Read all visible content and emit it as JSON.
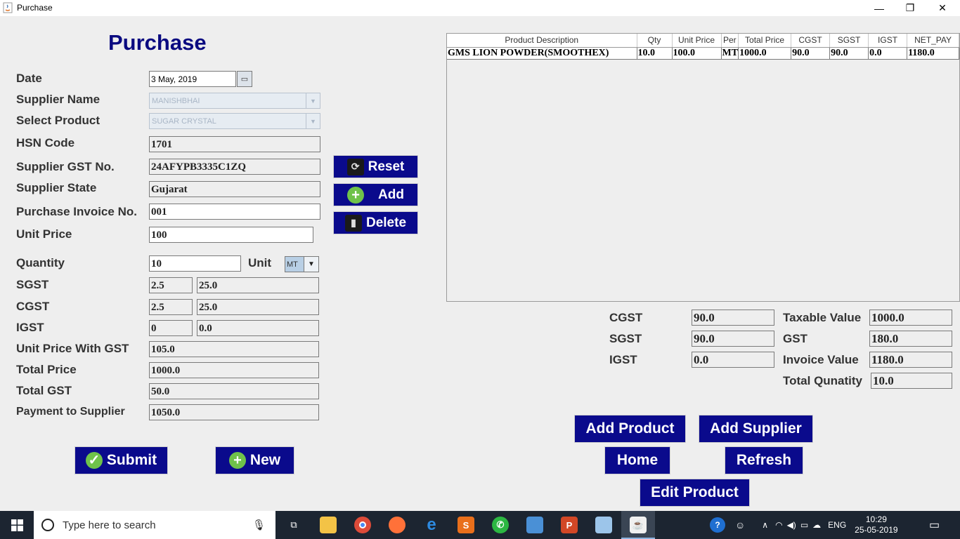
{
  "window": {
    "title": "Purchase",
    "minimize": "—",
    "restore": "❐",
    "close": "✕"
  },
  "form": {
    "heading": "Purchase",
    "date": {
      "label": "Date",
      "value": "3 May, 2019"
    },
    "supplier_name": {
      "label": "Supplier Name",
      "value": "MANISHBHAI"
    },
    "select_product": {
      "label": "Select Product",
      "value": "SUGAR CRYSTAL"
    },
    "hsn_code": {
      "label": "HSN Code",
      "value": "1701"
    },
    "supplier_gst": {
      "label": "Supplier GST No.",
      "value": "24AFYPB3335C1ZQ"
    },
    "supplier_state": {
      "label": "Supplier State",
      "value": "Gujarat"
    },
    "invoice_no": {
      "label": "Purchase Invoice No.",
      "value": "001"
    },
    "unit_price": {
      "label": "Unit Price",
      "value": "100"
    },
    "quantity": {
      "label": "Quantity",
      "value": "10"
    },
    "unit": {
      "label": "Unit",
      "value": "MT"
    },
    "sgst": {
      "label": "SGST",
      "rate": "2.5",
      "amount": "25.0"
    },
    "cgst": {
      "label": "CGST",
      "rate": "2.5",
      "amount": "25.0"
    },
    "igst": {
      "label": "IGST",
      "rate": "0",
      "amount": "0.0"
    },
    "unit_price_gst": {
      "label": "Unit Price With GST",
      "value": "105.0"
    },
    "total_price": {
      "label": "Total Price",
      "value": "1000.0"
    },
    "total_gst": {
      "label": "Total GST",
      "value": "50.0"
    },
    "payment": {
      "label": "Payment to Supplier",
      "value": "1050.0"
    }
  },
  "buttons": {
    "reset": "Reset",
    "add": "Add",
    "delete": "Delete",
    "submit": "Submit",
    "new": "New",
    "add_product": "Add Product",
    "add_supplier": "Add Supplier",
    "home": "Home",
    "refresh": "Refresh",
    "edit_product": "Edit Product"
  },
  "table": {
    "columns": [
      "Product Description",
      "Qty",
      "Unit Price",
      "Per",
      "Total Price",
      "CGST",
      "SGST",
      "IGST",
      "NET_PAY"
    ],
    "rows": [
      [
        "GMS LION POWDER(SMOOTHEX)",
        "10.0",
        "100.0",
        "MT",
        "1000.0",
        "90.0",
        "90.0",
        "0.0",
        "1180.0"
      ]
    ]
  },
  "summary": {
    "cgst": {
      "label": "CGST",
      "value": "90.0"
    },
    "sgst": {
      "label": "SGST",
      "value": "90.0"
    },
    "igst": {
      "label": "IGST",
      "value": "0.0"
    },
    "taxable": {
      "label": "Taxable Value",
      "value": "1000.0"
    },
    "gst": {
      "label": "GST",
      "value": "180.0"
    },
    "invoice_value": {
      "label": "Invoice Value",
      "value": "1180.0"
    },
    "total_quantity": {
      "label": "Total Qunatity",
      "value": "10.0"
    }
  },
  "taskbar": {
    "search_placeholder": "Type here to search",
    "language": "ENG",
    "time": "10:29",
    "date": "25-05-2019"
  }
}
